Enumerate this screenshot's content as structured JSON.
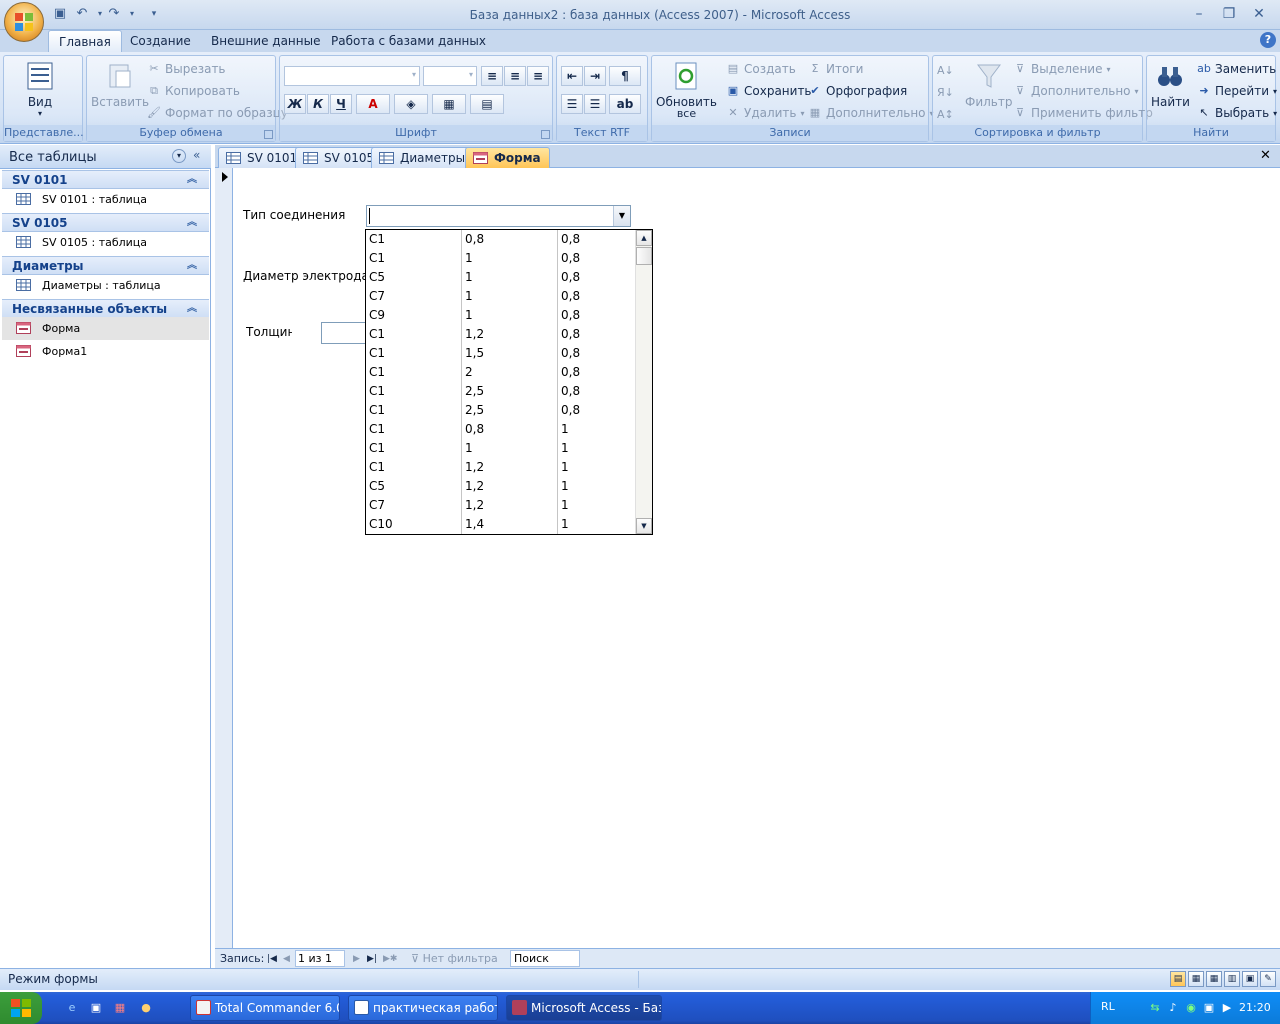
{
  "window": {
    "title": "База данных2 : база данных (Access 2007) - Microsoft Access"
  },
  "ribbon_tabs": [
    "Главная",
    "Создание",
    "Внешние данные",
    "Работа с базами данных"
  ],
  "ribbon": {
    "views": {
      "label": "Вид",
      "group": "Представле..."
    },
    "clipboard": {
      "paste": "Вставить",
      "cut": "Вырезать",
      "copy": "Копировать",
      "format_painter": "Формат по образцу",
      "group": "Буфер обмена"
    },
    "font": {
      "bold": "Ж",
      "italic": "К",
      "underline": "Ч",
      "font_color": "А",
      "group": "Шрифт"
    },
    "rich_text": {
      "group": "Текст RTF"
    },
    "records": {
      "refresh": "Обновить",
      "refresh_sub": "все",
      "new": "Создать",
      "save": "Сохранить",
      "delete": "Удалить",
      "totals": "Итоги",
      "spelling": "Орфография",
      "more": "Дополнительно",
      "group": "Записи"
    },
    "sort_filter": {
      "filter": "Фильтр",
      "selection": "Выделение",
      "advanced": "Дополнительно",
      "toggle_filter": "Применить фильтр",
      "group": "Сортировка и фильтр"
    },
    "find": {
      "find": "Найти",
      "replace": "Заменить",
      "goto": "Перейти",
      "select": "Выбрать",
      "group": "Найти"
    }
  },
  "nav": {
    "header": "Все таблицы",
    "groups": [
      {
        "title": "SV 0101",
        "items": [
          "SV 0101 : таблица"
        ]
      },
      {
        "title": "SV 0105",
        "items": [
          "SV 0105 : таблица"
        ]
      },
      {
        "title": "Диаметры",
        "items": [
          "Диаметры : таблица"
        ]
      },
      {
        "title": "Несвязанные объекты",
        "items": [
          "Форма",
          "Форма1"
        ]
      }
    ]
  },
  "doc_tabs": [
    "SV 0101",
    "SV 0105",
    "Диаметры",
    "Форма"
  ],
  "form": {
    "labels": {
      "connection_type": "Тип соединения",
      "electrode_diameter": "Диаметр электрода",
      "thickness": "Толщин"
    },
    "combo_value": "",
    "dropdown_rows": [
      [
        "C1",
        "0,8",
        "0,8"
      ],
      [
        "C1",
        "1",
        "0,8"
      ],
      [
        "C5",
        "1",
        "0,8"
      ],
      [
        "C7",
        "1",
        "0,8"
      ],
      [
        "C9",
        "1",
        "0,8"
      ],
      [
        "C1",
        "1,2",
        "0,8"
      ],
      [
        "C1",
        "1,5",
        "0,8"
      ],
      [
        "C1",
        "2",
        "0,8"
      ],
      [
        "C1",
        "2,5",
        "0,8"
      ],
      [
        "C1",
        "2,5",
        "0,8"
      ],
      [
        "C1",
        "0,8",
        "1"
      ],
      [
        "C1",
        "1",
        "1"
      ],
      [
        "C1",
        "1,2",
        "1"
      ],
      [
        "C5",
        "1,2",
        "1"
      ],
      [
        "C7",
        "1,2",
        "1"
      ],
      [
        "C10",
        "1,4",
        "1"
      ]
    ]
  },
  "record_nav": {
    "label": "Запись:",
    "position": "1 из 1",
    "filter": "Нет фильтра",
    "search": "Поиск"
  },
  "status": {
    "text": "Режим формы"
  },
  "taskbar": {
    "tasks": [
      "Total Commander 6.0...",
      "практическая работ...",
      "Microsoft Access - Баз..."
    ],
    "lang": "RL",
    "clock": "21:20"
  },
  "colors": {
    "accent": "#ffc557",
    "ribbon_blue": "#c7d8ee",
    "taskbar": "#245edb"
  }
}
